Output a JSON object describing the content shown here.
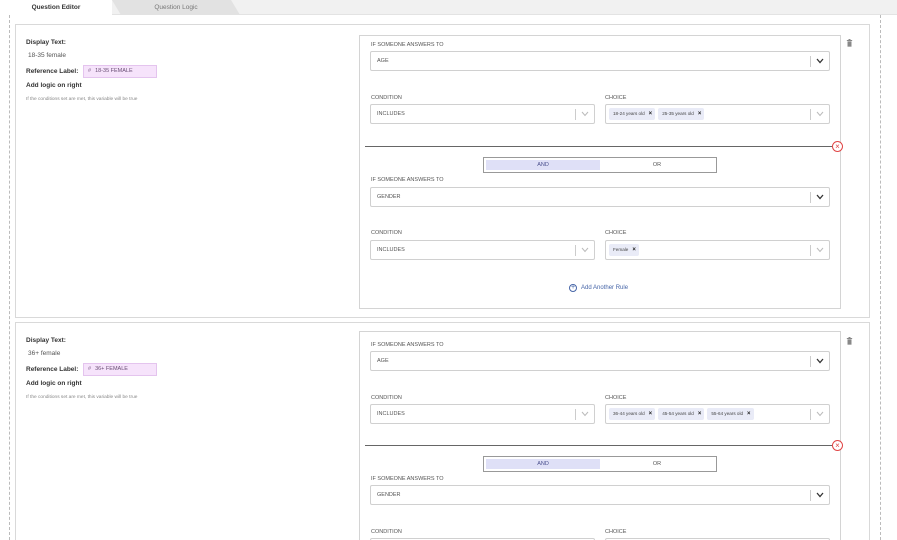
{
  "tabs": [
    {
      "label": "Question Editor",
      "active": true
    },
    {
      "label": "Question Logic",
      "active": false
    }
  ],
  "labels": {
    "display_text": "Display Text:",
    "reference_label": "Reference Label:",
    "add_logic": "Add logic on right",
    "hint": "If the conditions set are met, this variable will be true",
    "if_answers": "IF SOMEONE ANSWERS TO",
    "condition": "CONDITION",
    "choice": "CHOICE",
    "and": "AND",
    "or": "OR",
    "add_rule": "Add Another Rule",
    "remove": "×",
    "chip_remove": "×",
    "hash": "#"
  },
  "variables": [
    {
      "display_text": "18-35 female",
      "reference_label": "18-35 FEMALE",
      "rules": [
        {
          "question": "AGE",
          "condition": "INCLUDES",
          "choices": [
            "18-24 years old",
            "25-35 years old"
          ]
        },
        {
          "question": "GENDER",
          "condition": "INCLUDES",
          "choices": [
            "Female"
          ]
        }
      ],
      "joiner": "AND"
    },
    {
      "display_text": "36+ female",
      "reference_label": "36+ FEMALE",
      "rules": [
        {
          "question": "AGE",
          "condition": "INCLUDES",
          "choices": [
            "36-44 years old",
            "45-54 years old",
            "55-64 years old"
          ]
        },
        {
          "question": "GENDER",
          "condition": "",
          "choices": []
        }
      ],
      "joiner": "AND"
    }
  ],
  "colors": {
    "accent": "#4766a8",
    "reference_bg": "#f6e3fb",
    "chip_bg": "#e9ebf7",
    "toggle_selected": "#dfe0f7",
    "remove": "#e04545"
  },
  "icons": {
    "trash": "trash-icon",
    "chevron": "chevron-down-icon",
    "remove": "close-circle-icon",
    "add": "plus-circle-icon"
  }
}
